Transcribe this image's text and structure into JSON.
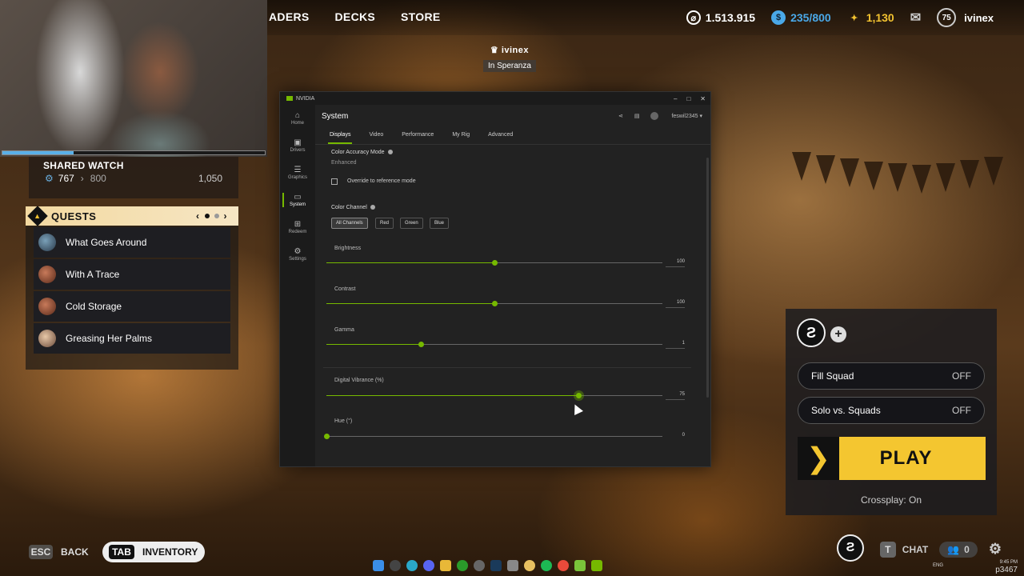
{
  "topnav": {
    "items": [
      "ADERS",
      "DECKS",
      "STORE"
    ]
  },
  "currencies": [
    {
      "icon": "credits-icon",
      "value": "1.513.915",
      "color": "#ffffff"
    },
    {
      "icon": "tokens-icon",
      "value": "235/800",
      "color": "#4aa8e8"
    },
    {
      "icon": "premium-icon",
      "value": "1,130",
      "color": "#f2c230"
    }
  ],
  "profile": {
    "level": "75",
    "username": "ivinex"
  },
  "shared_watch": {
    "title": "SHARED WATCH",
    "current": "767",
    "target": "800",
    "max": "1,050",
    "cam_progress": 0.27
  },
  "quests": {
    "title": "QUESTS",
    "page_current": 1,
    "page_total": 2,
    "items": [
      "What Goes Around",
      "With A Trace",
      "Cold Storage",
      "Greasing Her Palms"
    ]
  },
  "player_tag": {
    "name": "ivinex",
    "location": "In Speranza"
  },
  "nvidia": {
    "app_title": "NVIDIA",
    "nav": [
      {
        "icon": "home-icon",
        "label": "Home"
      },
      {
        "icon": "drivers-icon",
        "label": "Drivers"
      },
      {
        "icon": "graphics-icon",
        "label": "Graphics"
      },
      {
        "icon": "system-icon",
        "label": "System"
      },
      {
        "icon": "redeem-icon",
        "label": "Redeem"
      },
      {
        "icon": "settings-icon",
        "label": "Settings"
      }
    ],
    "active_nav": "System",
    "page_title": "System",
    "user": "feswil2345",
    "tabs": [
      "Displays",
      "Video",
      "Performance",
      "My Rig",
      "Advanced"
    ],
    "active_tab": "Displays",
    "color_accuracy": {
      "label": "Color Accuracy Mode",
      "value": "Enhanced",
      "override_label": "Override to reference mode"
    },
    "color_channel": {
      "label": "Color Channel",
      "chips": [
        "All Channels",
        "Red",
        "Green",
        "Blue"
      ],
      "selected": "All Channels"
    },
    "sliders": [
      {
        "label": "Brightness",
        "value": "100",
        "fraction": 0.5
      },
      {
        "label": "Contrast",
        "value": "100",
        "fraction": 0.5
      },
      {
        "label": "Gamma",
        "value": "1",
        "fraction": 0.28
      },
      {
        "label": "Digital Vibrance (%)",
        "value": "75",
        "fraction": 0.75
      },
      {
        "label": "Hue (°)",
        "value": "0",
        "fraction": 0.0
      }
    ]
  },
  "squad": {
    "options": [
      {
        "label": "Fill Squad",
        "value": "OFF"
      },
      {
        "label": "Solo vs. Squads",
        "value": "OFF"
      }
    ],
    "play_label": "PLAY",
    "crossplay": "Crossplay: On"
  },
  "bottom": {
    "back_key": "ESC",
    "back_label": "BACK",
    "inventory_key": "TAB",
    "inventory_label": "INVENTORY",
    "chat_key": "T",
    "chat_label": "CHAT",
    "friends_count": "0"
  },
  "system_tray": {
    "lang": "ENG",
    "time": "9:45 PM",
    "username_tail": "p3467"
  },
  "colors": {
    "accent_green": "#76b900",
    "play_yellow": "#f4c630"
  }
}
